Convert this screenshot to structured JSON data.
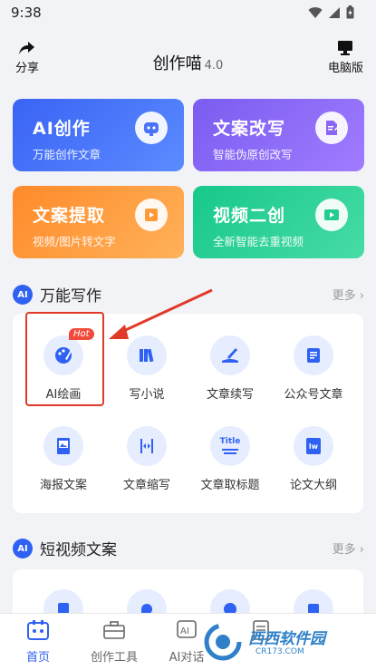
{
  "status_bar": {
    "time": "9:38"
  },
  "header": {
    "share_label": "分享",
    "title": "创作喵",
    "version": "4.0",
    "pc_label": "电脑版"
  },
  "feature_cards": [
    {
      "title": "AI创作",
      "subtitle": "万能创作文章",
      "icon": "robot-icon"
    },
    {
      "title": "文案改写",
      "subtitle": "智能伪原创改写",
      "icon": "edit-doc-icon"
    },
    {
      "title": "文案提取",
      "subtitle": "视频/图片转文字",
      "icon": "video-extract-icon"
    },
    {
      "title": "视频二创",
      "subtitle": "全新智能去重视频",
      "icon": "video-remix-icon"
    }
  ],
  "sections": {
    "writing": {
      "badge": "AI",
      "title": "万能写作",
      "more": "更多",
      "tools": [
        {
          "label": "AI绘画",
          "icon": "palette-icon",
          "badge": "Hot"
        },
        {
          "label": "写小说",
          "icon": "books-icon"
        },
        {
          "label": "文章续写",
          "icon": "pen-write-icon"
        },
        {
          "label": "公众号文章",
          "icon": "article-icon"
        },
        {
          "label": "海报文案",
          "icon": "poster-icon"
        },
        {
          "label": "文章缩写",
          "icon": "compress-icon"
        },
        {
          "label": "文章取标题",
          "icon": "title-icon",
          "glyph": "Title"
        },
        {
          "label": "论文大纲",
          "icon": "thesis-icon",
          "glyph": "lw"
        }
      ]
    },
    "short_video": {
      "badge": "AI",
      "title": "短视频文案",
      "more": "更多"
    }
  },
  "bottom_nav": {
    "items": [
      {
        "label": "首页",
        "icon": "home-icon",
        "active": true
      },
      {
        "label": "创作工具",
        "icon": "toolbox-icon",
        "active": false
      },
      {
        "label": "AI对话",
        "icon": "ai-chat-icon",
        "active": false
      },
      {
        "label": "",
        "icon": "doc-icon",
        "active": false
      }
    ]
  },
  "watermark": {
    "brand": "西西软件园",
    "site": "CR173.COM"
  },
  "colors": {
    "accent": "#2f62f2",
    "hot": "#f24a3a",
    "highlight": "#e03a2a"
  }
}
